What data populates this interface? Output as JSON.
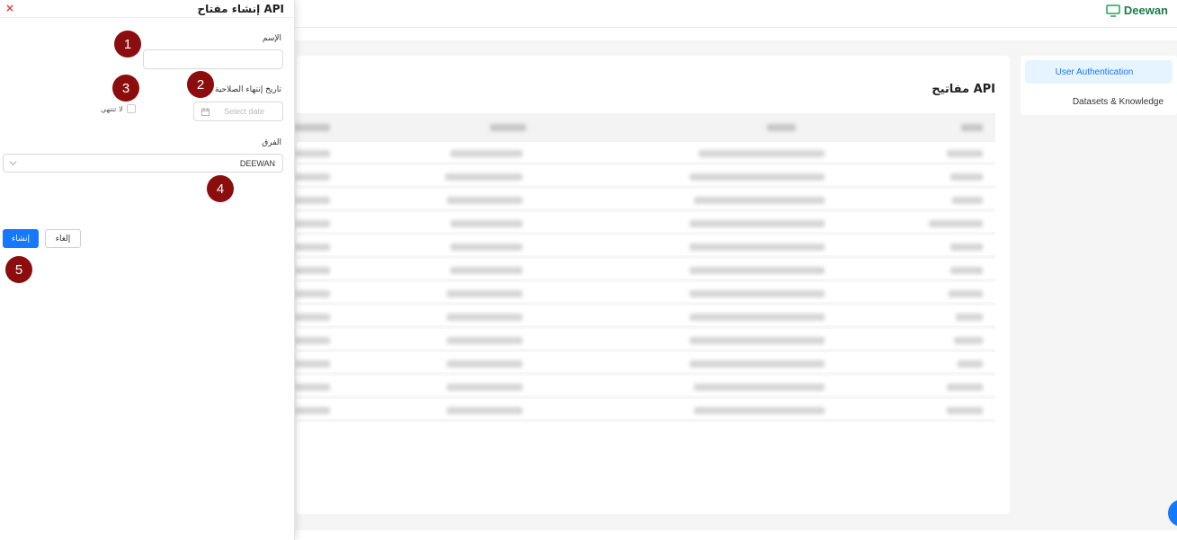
{
  "app": {
    "brand": "Deewan"
  },
  "sidebar": {
    "items": [
      {
        "label": "User Authentication",
        "active": true
      },
      {
        "label": "Datasets & Knowledge",
        "active": false
      }
    ]
  },
  "content": {
    "title": "مفاتيح API"
  },
  "drawer": {
    "title": "إنشاء مفتاح API",
    "close": "×",
    "name_label": "الإسم",
    "name_value": "",
    "expiry_label": "تاريخ إنتهاء الصلاحية",
    "expiry_placeholder": "Select date",
    "never_expire_label": "لا تنتهي",
    "teams_label": "الفرق",
    "teams_value": "DEEWAN",
    "create_button": "إنشاء",
    "cancel_button": "إلغاء"
  },
  "markers": [
    "1",
    "2",
    "3",
    "4",
    "5"
  ],
  "colors": {
    "primary": "#1677ff",
    "brand": "#1f7a4d",
    "marker": "#8b0d0d",
    "close": "#e53935"
  }
}
